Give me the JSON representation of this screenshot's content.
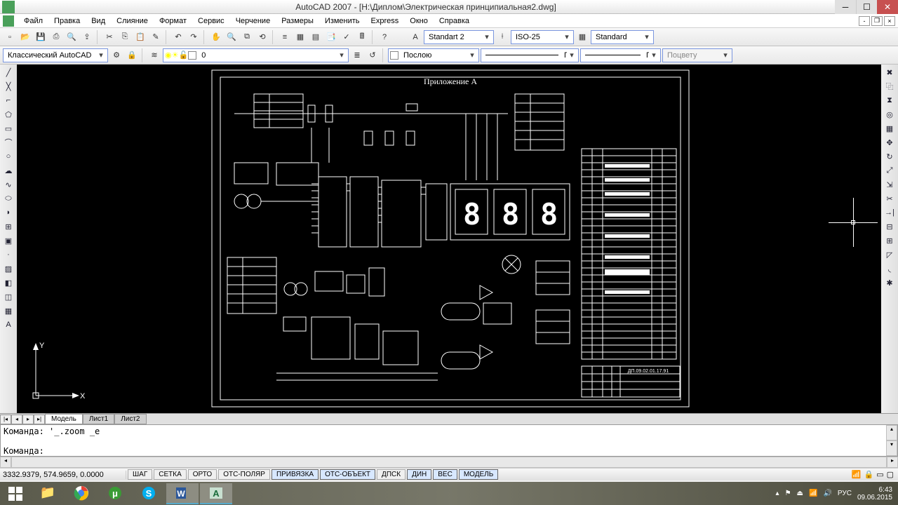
{
  "titlebar": {
    "title": "AutoCAD 2007 - [Н:\\Диплом\\Электрическая принципиальная2.dwg]"
  },
  "menu": {
    "items": [
      "Файл",
      "Правка",
      "Вид",
      "Слияние",
      "Формат",
      "Сервис",
      "Черчение",
      "Размеры",
      "Изменить",
      "Express",
      "Окно",
      "Справка"
    ]
  },
  "toolbar1": {
    "textstyle": "Standart 2",
    "dimstyle": "ISO-25",
    "tablestyle": "Standard"
  },
  "toolbar2": {
    "workspace": "Классический AutoCAD",
    "layer": "0",
    "linetype1": "Послою",
    "linetype2": "Послою",
    "linetype3": "Послою",
    "color": "Поцвету"
  },
  "drawing": {
    "title": "Приложение А",
    "titleblock_code": "ДП.09.02.01.17.91",
    "segments": [
      "8",
      "8",
      "8"
    ]
  },
  "ucs": {
    "y": "Y",
    "x": "X"
  },
  "tabs": {
    "model": "Модель",
    "sheet1": "Лист1",
    "sheet2": "Лист2"
  },
  "command": {
    "line1": "Команда: '_.zoom _e",
    "line2": "Команда:"
  },
  "status": {
    "coords": "3332.9379, 574.9659, 0.0000",
    "buttons": [
      "ШАГ",
      "СЕТКА",
      "ОРТО",
      "ОТС-ПОЛЯР",
      "ПРИВЯЗКА",
      "ОТС-ОБЪЕКТ",
      "ДПСК",
      "ДИН",
      "ВЕС",
      "МОДЕЛЬ"
    ],
    "active_buttons": [
      "ПРИВЯЗКА",
      "ОТС-ОБЪЕКТ",
      "ДИН",
      "ВЕС",
      "МОДЕЛЬ"
    ]
  },
  "systray": {
    "lang": "РУС",
    "time": "6:43",
    "date": "09.06.2015"
  }
}
